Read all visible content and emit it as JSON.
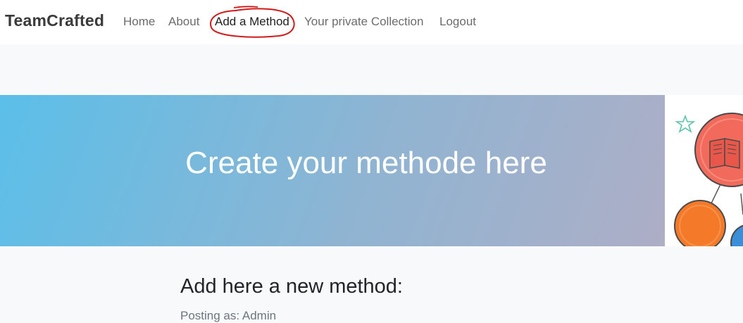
{
  "navbar": {
    "brand": "TeamCrafted",
    "links": [
      {
        "label": "Home"
      },
      {
        "label": "About"
      },
      {
        "label": "Add a Method"
      },
      {
        "label": "Your private Collection"
      },
      {
        "label": "Logout"
      }
    ],
    "active_link": "Add a Method",
    "annotation_color": "#d11a1a"
  },
  "hero": {
    "title": "Create your methode here",
    "gradient_colors": [
      "#5bbfe9",
      "#aeaec6"
    ]
  },
  "illustration": {
    "icons": [
      "star-icon",
      "book-icon"
    ],
    "circle_colors": [
      "#f26a5c",
      "#f47a2a",
      "#3a8fd8"
    ]
  },
  "main": {
    "section_title": "Add here a new method:",
    "posting_as": "Posting as: Admin"
  }
}
